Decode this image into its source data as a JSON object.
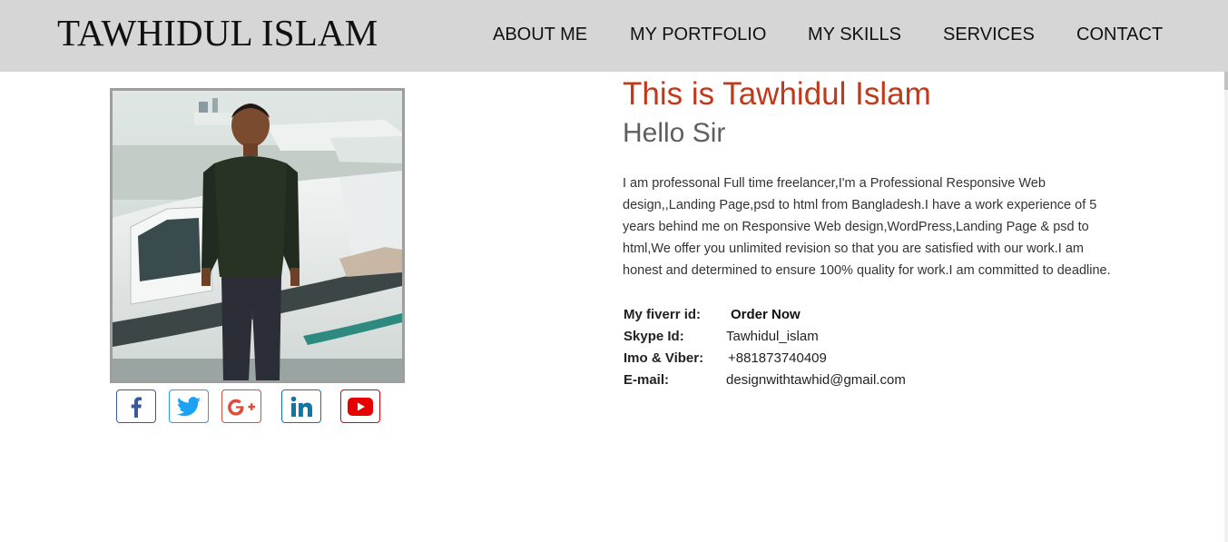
{
  "header": {
    "brand": "TAWHIDUL ISLAM",
    "nav": [
      "ABOUT ME",
      "MY PORTFOLIO",
      "MY SKILLS",
      "SERVICES",
      "CONTACT"
    ]
  },
  "profile": {
    "title": "This is Tawhidul Islam",
    "subtitle": "Hello Sir",
    "bio": "I am professonal Full time freelancer,I'm a Professional Responsive Web design,,Landing Page,psd to html from Bangladesh.I have a work experience of 5 years behind me on Responsive Web design,WordPress,Landing Page & psd to html,We offer you unlimited revision so that you are satisfied with our work.I am honest and determined to ensure 100% quality for work.I am committed to deadline.",
    "info": {
      "fiverr_label": "My fiverr id:",
      "fiverr_value": "Order Now",
      "skype_label": "Skype Id:",
      "skype_value": "Tawhidul_islam",
      "imo_label": "Imo & Viber:",
      "imo_value": "+881873740409",
      "email_label": "E-mail:",
      "email_value": "designwithtawhid@gmail.com"
    }
  },
  "social_icons": [
    "facebook-icon",
    "twitter-icon",
    "google-plus-icon",
    "linkedin-icon",
    "youtube-icon"
  ],
  "colors": {
    "header_bg": "#d6d6d6",
    "title": "#c0391b",
    "subtitle": "#5f5f5f",
    "facebook": "#3b5998",
    "twitter": "#1da1f2",
    "google_plus": "#dd4b39",
    "linkedin": "#0e76a8",
    "youtube": "#e60000"
  }
}
